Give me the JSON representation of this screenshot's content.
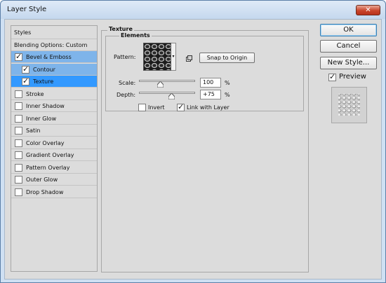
{
  "window": {
    "title": "Layer Style",
    "close_glyph": "✕"
  },
  "styles_panel": {
    "header": "Styles",
    "blending": "Blending Options: Custom",
    "items": [
      {
        "label": "Bevel & Emboss",
        "checked": true,
        "selected": true
      },
      {
        "label": "Contour",
        "checked": true,
        "selected": true,
        "sub": true
      },
      {
        "label": "Texture",
        "checked": true,
        "selected": true,
        "sub": true,
        "active": true
      },
      {
        "label": "Stroke",
        "checked": false
      },
      {
        "label": "Inner Shadow",
        "checked": false
      },
      {
        "label": "Inner Glow",
        "checked": false
      },
      {
        "label": "Satin",
        "checked": false
      },
      {
        "label": "Color Overlay",
        "checked": false
      },
      {
        "label": "Gradient Overlay",
        "checked": false
      },
      {
        "label": "Pattern Overlay",
        "checked": false
      },
      {
        "label": "Outer Glow",
        "checked": false
      },
      {
        "label": "Drop Shadow",
        "checked": false
      }
    ]
  },
  "texture": {
    "group_title": "Texture",
    "elements_title": "Elements",
    "pattern_label": "Pattern:",
    "snap_button": "Snap to Origin",
    "scale_label": "Scale:",
    "scale_value": "100",
    "scale_unit": "%",
    "scale_level": 0.38,
    "depth_label": "Depth:",
    "depth_value": "+75",
    "depth_unit": "%",
    "depth_level": 0.58,
    "invert_label": "Invert",
    "invert_checked": false,
    "link_label": "Link with Layer",
    "link_checked": true
  },
  "buttons": {
    "ok": "OK",
    "cancel": "Cancel",
    "new_style": "New Style..."
  },
  "preview": {
    "label": "Preview",
    "checked": true
  },
  "icons": {
    "check": "✓",
    "dropdown": "▾",
    "new_preset": "new-preset-icon"
  }
}
